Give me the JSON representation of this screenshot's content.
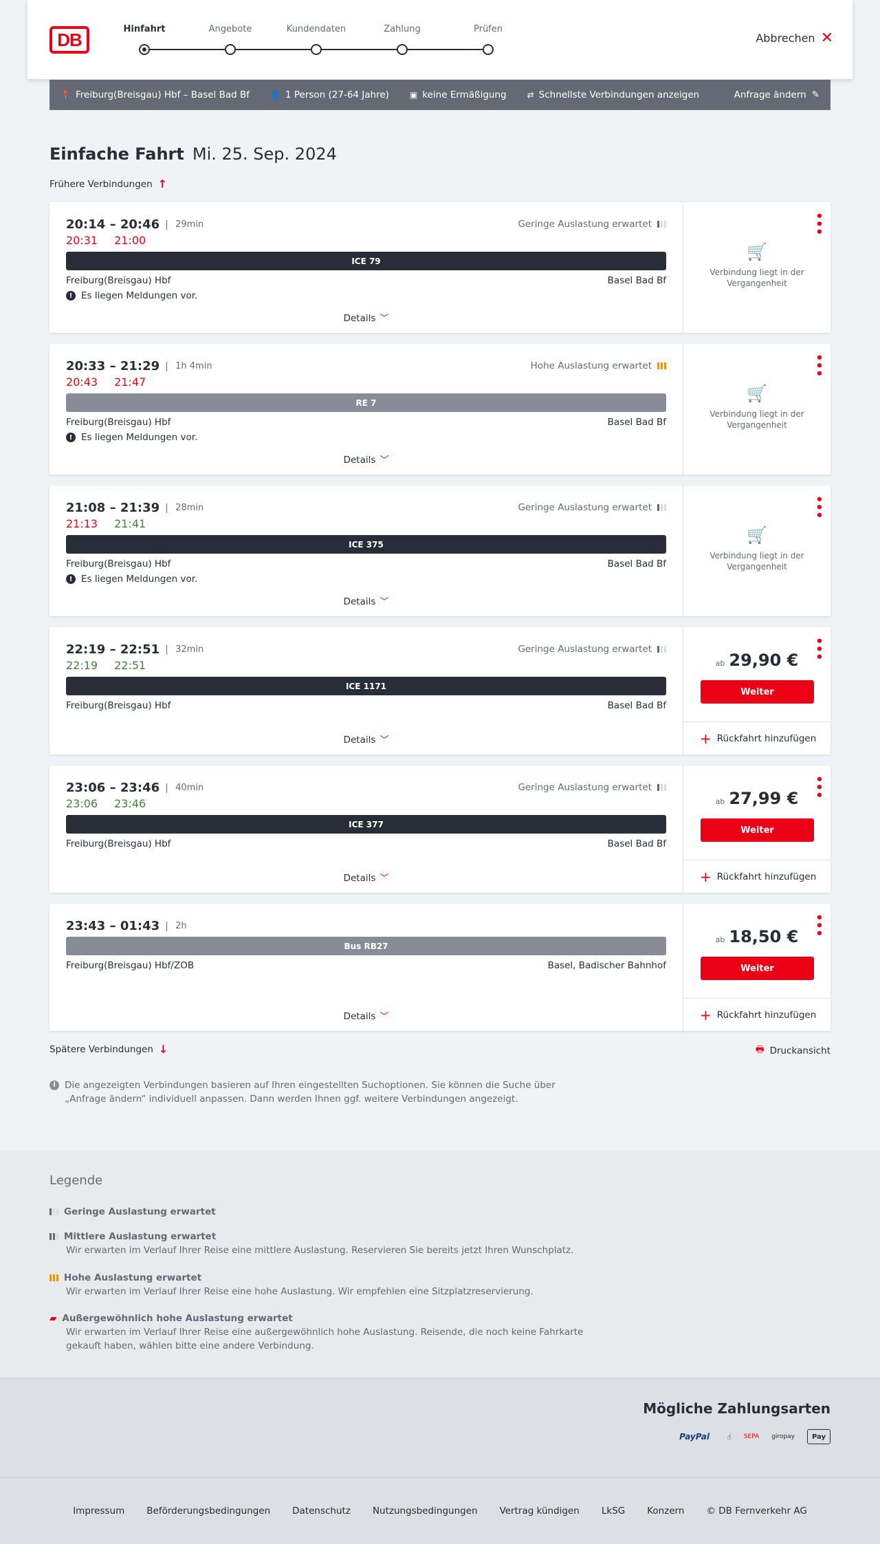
{
  "header": {
    "logo": "DB",
    "cancel": "Abbrechen",
    "steps": [
      {
        "label": "Hinfahrt",
        "active": true
      },
      {
        "label": "Angebote"
      },
      {
        "label": "Kundendaten"
      },
      {
        "label": "Zahlung"
      },
      {
        "label": "Prüfen"
      }
    ]
  },
  "search": {
    "route": "Freiburg(Breisgau) Hbf – Basel Bad Bf",
    "persons": "1 Person (27-64 Jahre)",
    "discount": "keine Ermäßigung",
    "fastest": "Schnellste Verbindungen anzeigen",
    "edit": "Anfrage ändern"
  },
  "title": {
    "kind": "Einfache Fahrt",
    "date": "Mi. 25. Sep. 2024"
  },
  "earlier": "Frühere Verbindungen",
  "later": "Spätere Verbindungen",
  "print": "Druckansicht",
  "details": "Details",
  "notice": "Es liegen Meldungen vor.",
  "past_text": "Verbindung liegt in der Vergangenheit",
  "weiter": "Weiter",
  "rueckfahrt": "Rückfahrt hinzufügen",
  "ab": "ab",
  "connections": [
    {
      "times": "20:14 – 20:46",
      "duration": "29min",
      "rt_dep": "20:31",
      "rt_arr": "21:00",
      "load": "Geringe Auslastung erwartet",
      "train": "ICE 79",
      "from": "Freiburg(Breisgau) Hbf",
      "to": "Basel Bad Bf"
    },
    {
      "times": "20:33 – 21:29",
      "duration": "1h 4min",
      "rt_dep": "20:43",
      "rt_arr": "21:47",
      "load": "Hohe Auslastung erwartet",
      "train": "RE 7",
      "from": "Freiburg(Breisgau) Hbf",
      "to": "Basel Bad Bf"
    },
    {
      "times": "21:08 – 21:39",
      "duration": "28min",
      "rt_dep": "21:13",
      "rt_arr": "21:41",
      "load": "Geringe Auslastung erwartet",
      "train": "ICE 375",
      "from": "Freiburg(Breisgau) Hbf",
      "to": "Basel Bad Bf"
    },
    {
      "times": "22:19 – 22:51",
      "duration": "32min",
      "rt_dep": "22:19",
      "rt_arr": "22:51",
      "load": "Geringe Auslastung erwartet",
      "train": "ICE 1171",
      "from": "Freiburg(Breisgau) Hbf",
      "to": "Basel Bad Bf",
      "price": "29,90 €"
    },
    {
      "times": "23:06 – 23:46",
      "duration": "40min",
      "rt_dep": "23:06",
      "rt_arr": "23:46",
      "load": "Geringe Auslastung erwartet",
      "train": "ICE 377",
      "from": "Freiburg(Breisgau) Hbf",
      "to": "Basel Bad Bf",
      "price": "27,99 €"
    },
    {
      "times": "23:43 – 01:43",
      "duration": "2h",
      "train": "Bus RB27",
      "from": "Freiburg(Breisgau) Hbf/ZOB",
      "to": "Basel, Badischer Bahnhof",
      "price": "18,50 €"
    }
  ],
  "info": "Die angezeigten Verbindungen basieren auf Ihren eingestellten Suchoptionen. Sie können die Suche über „Anfrage ändern“ individuell anpassen. Dann werden Ihnen ggf. weitere Verbindungen angezeigt.",
  "legend": {
    "title": "Legende",
    "items": [
      {
        "title": "Geringe Auslastung erwartet"
      },
      {
        "title": "Mittlere Auslastung erwartet",
        "text": "Wir erwarten im Verlauf Ihrer Reise eine mittlere Auslastung. Reservieren Sie bereits jetzt Ihren Wunschplatz."
      },
      {
        "title": "Hohe Auslastung erwartet",
        "text": "Wir erwarten im Verlauf Ihrer Reise eine hohe Auslastung. Wir empfehlen eine Sitzplatzreservierung."
      },
      {
        "title": "Außergewöhnlich hohe Auslastung erwartet",
        "text": "Wir erwarten im Verlauf Ihrer Reise eine außergewöhnlich hohe Auslastung. Reisende, die noch keine Fahrkarte gekauft haben, wählen bitte eine andere Verbindung."
      }
    ]
  },
  "payment": {
    "title": "Mögliche Zahlungsarten",
    "paypal": "PayPal",
    "sepa": "SEPA",
    "giropay": "giropay",
    "applepay": "Pay"
  },
  "footer": [
    "Impressum",
    "Beförderungsbedingungen",
    "Datenschutz",
    "Nutzungsbedingungen",
    "Vertrag kündigen",
    "LkSG",
    "Konzern",
    "© DB Fernverkehr AG"
  ],
  "colors": {
    "red": "#ec0016",
    "dark": "#282d37",
    "green": "#408335",
    "orange": "#f39200"
  }
}
